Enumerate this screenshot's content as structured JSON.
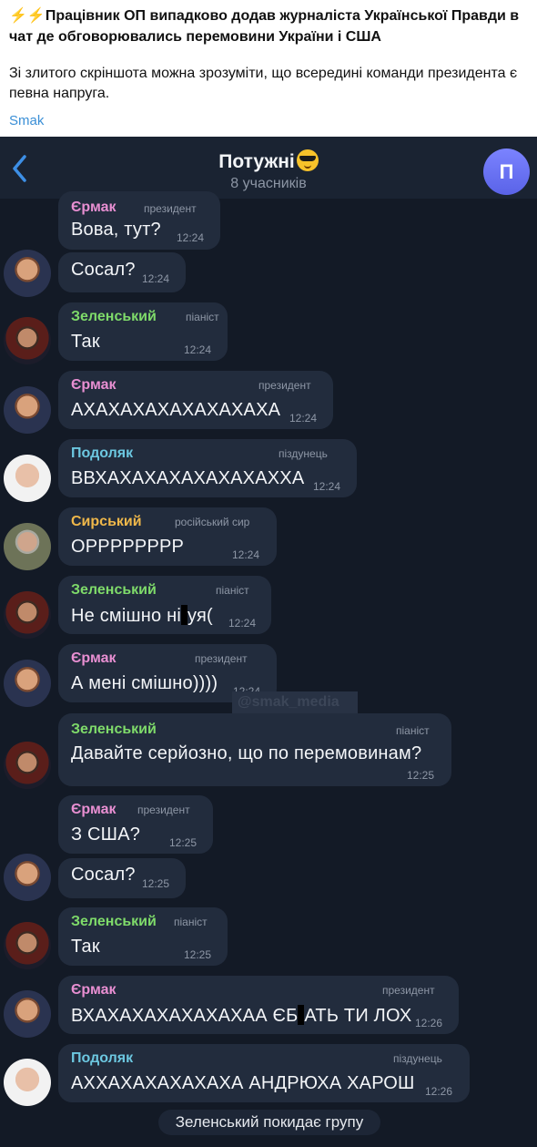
{
  "post": {
    "title_prefix": "⚡️⚡️",
    "title": "Працівник ОП випадково додав журналіста Української Правди в чат де обговорювались перемовини України і США",
    "text": "Зі злитого скріншота можна зрозуміти, що всередині команди президента є певна напруга.",
    "author": "Smak"
  },
  "chat": {
    "title": "Потужні",
    "subtitle": "8 учасників",
    "avatar_letter": "П",
    "watermark": "@smak_media",
    "service_message": "Зеленський покидає групу"
  },
  "messages": [
    {
      "name": "Єрмак",
      "role": "президент",
      "text": "Вова, тут?",
      "time": "12:24"
    },
    {
      "name": "",
      "role": "",
      "text": "Сосал?",
      "time": "12:24"
    },
    {
      "name": "Зеленський",
      "role": "піаніст",
      "text": "Так",
      "time": "12:24"
    },
    {
      "name": "Єрмак",
      "role": "президент",
      "text": "АХАХАХАХАХАХАХАХА",
      "time": "12:24"
    },
    {
      "name": "Подоляк",
      "role": "піздунець",
      "text": "ВВХАХАХАХАХАХАХАХХА",
      "time": "12:24"
    },
    {
      "name": "Сирський",
      "role": "російський сир",
      "text": "ОРРРРРРРР",
      "time": "12:24"
    },
    {
      "name": "Зеленський",
      "role": "піаніст",
      "text_a": "Не смішно ні",
      "text_b": "уя(",
      "time": "12:24"
    },
    {
      "name": "Єрмак",
      "role": "президент",
      "text": "А мені смішно))))",
      "time": "12:24"
    },
    {
      "name": "Зеленський",
      "role": "піаніст",
      "text": "Давайте серйозно, що по перемовинам?",
      "time": "12:25"
    },
    {
      "name": "Єрмак",
      "role": "президент",
      "text": "З США?",
      "time": "12:25"
    },
    {
      "name": "",
      "role": "",
      "text": "Сосал?",
      "time": "12:25"
    },
    {
      "name": "Зеленський",
      "role": "піаніст",
      "text": "Так",
      "time": "12:25"
    },
    {
      "name": "Єрмак",
      "role": "президент",
      "text_a": "ВХАХАХАХАХАХАХАА ЄБ",
      "text_b": "АТЬ ТИ ЛОХ",
      "time": "12:26"
    },
    {
      "name": "Подоляк",
      "role": "піздунець",
      "text": "АХХАХАХАХАХАХА АНДРЮХА ХАРОШ",
      "time": "12:26"
    }
  ],
  "colors": {
    "chat_bg": "#131a26",
    "bubble_bg": "#222c3d",
    "yermak_name": "#e88fd2",
    "zelensky_name": "#7fdb6a",
    "podolyak_name": "#6cc7e0",
    "syrsky_name": "#f0b84a",
    "link": "#3a8fd6"
  }
}
